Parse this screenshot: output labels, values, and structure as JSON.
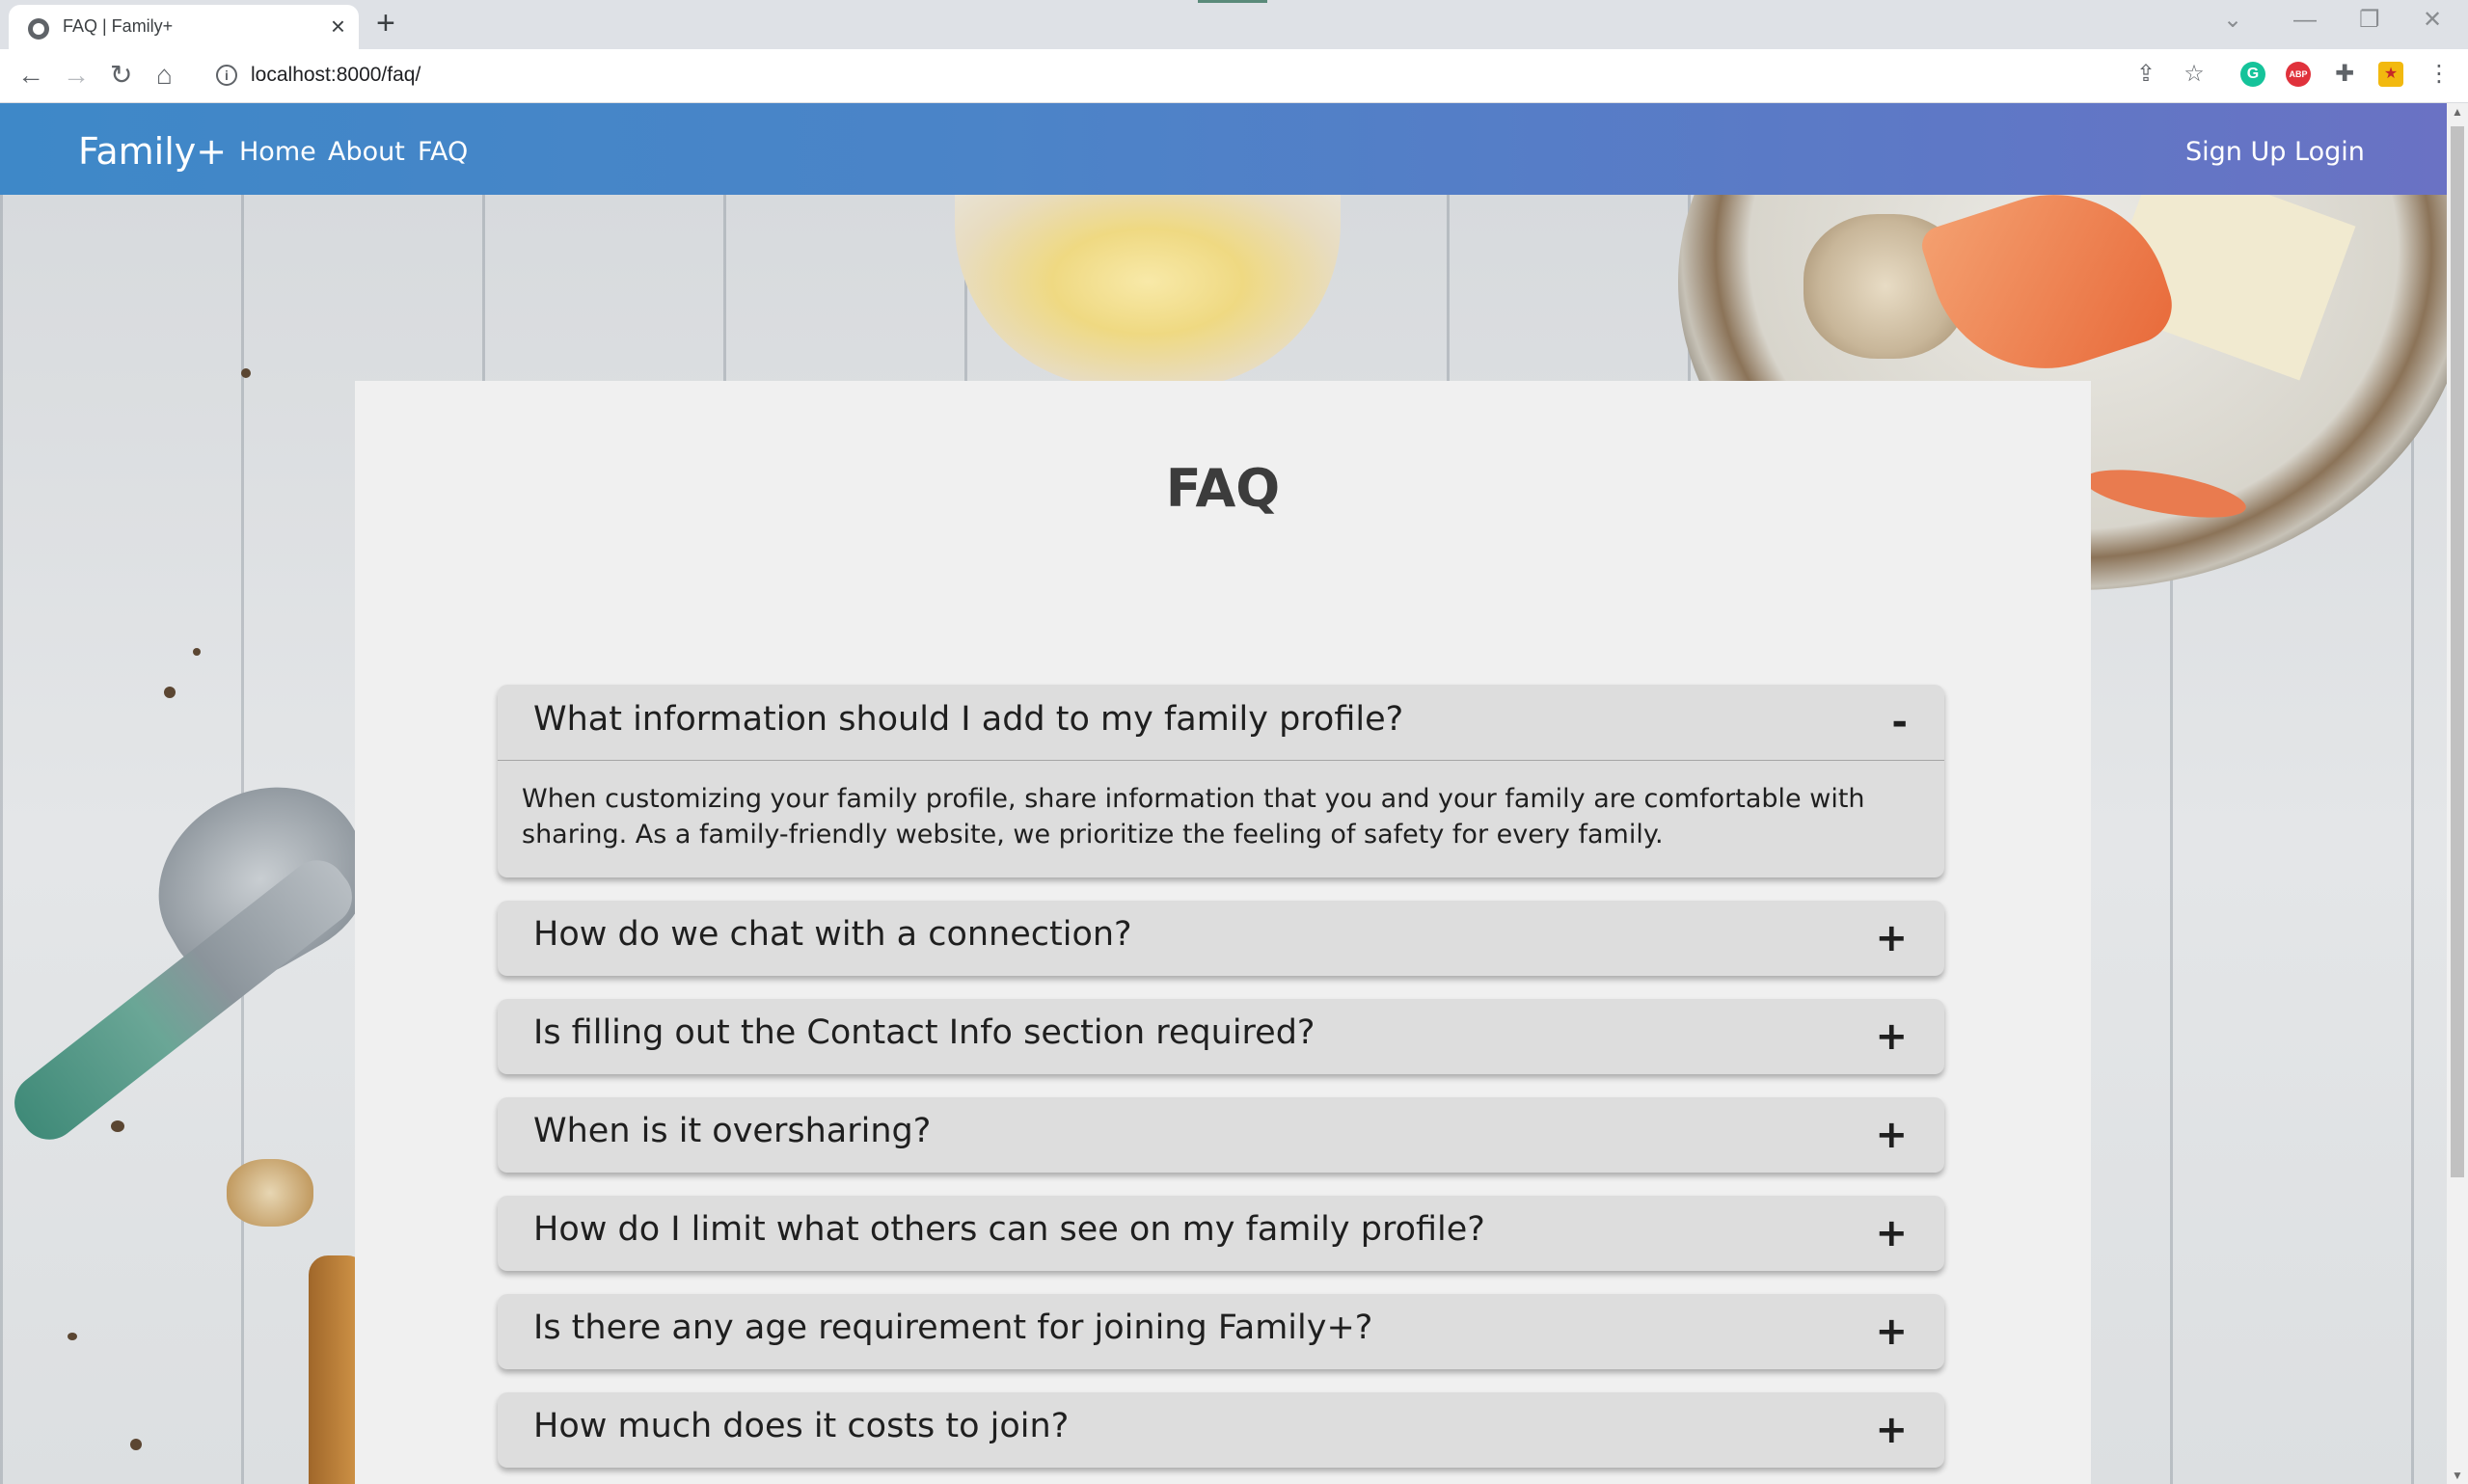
{
  "browser": {
    "tab_title": "FAQ | Family+",
    "tab_close": "×",
    "new_tab": "+",
    "url": "localhost:8000/faq/"
  },
  "site": {
    "brand": "Family+",
    "nav_left": [
      "Home",
      "About",
      "FAQ"
    ],
    "nav_right": [
      "Sign Up",
      "Login"
    ]
  },
  "faq": {
    "title": "FAQ",
    "items": [
      {
        "question": "What information should I add to my family profile?",
        "toggle": "-",
        "expanded": true,
        "answer": "When customizing your family profile, share information that you and your family are comfortable with sharing. As a family-friendly website, we prioritize the feeling of safety for every family."
      },
      {
        "question": "How do we chat with a connection?",
        "toggle": "+",
        "expanded": false
      },
      {
        "question": "Is filling out the Contact Info section required?",
        "toggle": "+",
        "expanded": false
      },
      {
        "question": "When is it oversharing?",
        "toggle": "+",
        "expanded": false
      },
      {
        "question": "How do I limit what others can see on my family profile?",
        "toggle": "+",
        "expanded": false
      },
      {
        "question": "Is there any age requirement for joining Family+?",
        "toggle": "+",
        "expanded": false
      },
      {
        "question": "How much does it costs to join?",
        "toggle": "+",
        "expanded": false
      }
    ]
  },
  "colors": {
    "nav_gradient_start": "#3e88c8",
    "nav_gradient_end": "#6a72c4",
    "card_bg": "#f0f0f0",
    "faq_item_bg": "#dddddd"
  }
}
